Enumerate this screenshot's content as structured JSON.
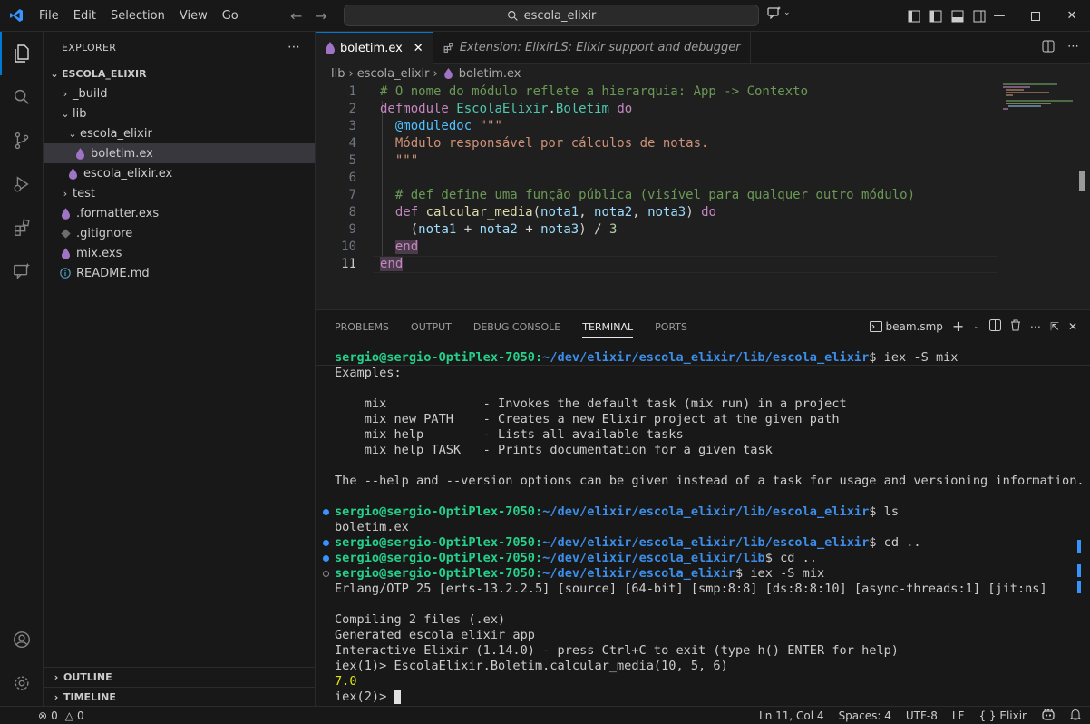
{
  "menu": [
    "File",
    "Edit",
    "Selection",
    "View",
    "Go"
  ],
  "search": {
    "text": "escola_elixir"
  },
  "explorer": {
    "header": "EXPLORER",
    "root": "ESCOLA_ELIXIR",
    "items": [
      {
        "label": "_build",
        "type": "folder",
        "open": false,
        "depth": 1
      },
      {
        "label": "lib",
        "type": "folder",
        "open": true,
        "depth": 1
      },
      {
        "label": "escola_elixir",
        "type": "folder",
        "open": true,
        "depth": 2
      },
      {
        "label": "boletim.ex",
        "type": "elixir",
        "depth": 3,
        "selected": true
      },
      {
        "label": "escola_elixir.ex",
        "type": "elixir",
        "depth": 2
      },
      {
        "label": "test",
        "type": "folder",
        "open": false,
        "depth": 1
      },
      {
        "label": ".formatter.exs",
        "type": "elixir-script",
        "depth": 1
      },
      {
        "label": ".gitignore",
        "type": "git",
        "depth": 1
      },
      {
        "label": "mix.exs",
        "type": "elixir-script",
        "depth": 1
      },
      {
        "label": "README.md",
        "type": "info",
        "depth": 1
      }
    ],
    "outline": "OUTLINE",
    "timeline": "TIMELINE"
  },
  "tabs": [
    {
      "label": "boletim.ex",
      "active": true
    },
    {
      "label": "Extension: ElixirLS: Elixir support and debugger",
      "active": false
    }
  ],
  "breadcrumb": [
    "lib",
    "escola_elixir",
    "boletim.ex"
  ],
  "code": {
    "current_line": 11,
    "lines": [
      [
        [
          "# O nome do módulo reflete a hierarquia: App -> Contexto",
          "com"
        ]
      ],
      [
        [
          "defmodule ",
          "kw"
        ],
        [
          "EscolaElixir",
          "mod"
        ],
        [
          ".",
          "plain"
        ],
        [
          "Boletim",
          "mod"
        ],
        [
          " do",
          "kw"
        ]
      ],
      [
        [
          "  ",
          "plain"
        ],
        [
          "@moduledoc",
          "attr"
        ],
        [
          " \"\"\"",
          "str"
        ]
      ],
      [
        [
          "  Módulo responsável por cálculos de notas.",
          "str"
        ]
      ],
      [
        [
          "  \"\"\"",
          "str"
        ]
      ],
      [
        [
          "",
          "plain"
        ]
      ],
      [
        [
          "  # def define uma função pública (visível para qualquer outro módulo)",
          "com"
        ]
      ],
      [
        [
          "  ",
          "plain"
        ],
        [
          "def ",
          "kw"
        ],
        [
          "calcular_media",
          "fn"
        ],
        [
          "(",
          "plain"
        ],
        [
          "nota1",
          "var"
        ],
        [
          ", ",
          "plain"
        ],
        [
          "nota2",
          "var"
        ],
        [
          ", ",
          "plain"
        ],
        [
          "nota3",
          "var"
        ],
        [
          ") ",
          "plain"
        ],
        [
          "do",
          "kw"
        ]
      ],
      [
        [
          "    (",
          "plain"
        ],
        [
          "nota1",
          "var"
        ],
        [
          " + ",
          "plain"
        ],
        [
          "nota2",
          "var"
        ],
        [
          " + ",
          "plain"
        ],
        [
          "nota3",
          "var"
        ],
        [
          ") / ",
          "plain"
        ],
        [
          "3",
          "num"
        ]
      ],
      [
        [
          "  ",
          "plain"
        ],
        [
          "end",
          "kw-hl"
        ]
      ],
      [
        [
          "end",
          "kw-hl"
        ]
      ]
    ]
  },
  "panel": {
    "tabs": [
      "PROBLEMS",
      "OUTPUT",
      "DEBUG CONSOLE",
      "TERMINAL",
      "PORTS"
    ],
    "active_tab": "TERMINAL",
    "terminal_name": "beam.smp"
  },
  "terminal": {
    "user": "sergio@sergio-OptiPlex-7050",
    "lines": [
      {
        "kind": "prompt",
        "path": "~/dev/elixir/escola_elixir/lib/escola_elixir",
        "cmd": " iex -S mix"
      },
      {
        "kind": "text",
        "text": "Examples:"
      },
      {
        "kind": "text",
        "text": ""
      },
      {
        "kind": "text",
        "text": "    mix             - Invokes the default task (mix run) in a project"
      },
      {
        "kind": "text",
        "text": "    mix new PATH    - Creates a new Elixir project at the given path"
      },
      {
        "kind": "text",
        "text": "    mix help        - Lists all available tasks"
      },
      {
        "kind": "text",
        "text": "    mix help TASK   - Prints documentation for a given task"
      },
      {
        "kind": "text",
        "text": ""
      },
      {
        "kind": "text",
        "text": "The --help and --version options can be given instead of a task for usage and versioning information."
      },
      {
        "kind": "text",
        "text": ""
      },
      {
        "kind": "prompt",
        "path": "~/dev/elixir/escola_elixir/lib/escola_elixir",
        "cmd": " ls",
        "deco": "ok"
      },
      {
        "kind": "text",
        "text": "boletim.ex"
      },
      {
        "kind": "prompt",
        "path": "~/dev/elixir/escola_elixir/lib/escola_elixir",
        "cmd": " cd ..",
        "deco": "ok"
      },
      {
        "kind": "prompt",
        "path": "~/dev/elixir/escola_elixir/lib",
        "cmd": " cd ..",
        "deco": "ok"
      },
      {
        "kind": "prompt",
        "path": "~/dev/elixir/escola_elixir",
        "cmd": " iex -S mix",
        "deco": "run"
      },
      {
        "kind": "text",
        "text": "Erlang/OTP 25 [erts-13.2.2.5] [source] [64-bit] [smp:8:8] [ds:8:8:10] [async-threads:1] [jit:ns]"
      },
      {
        "kind": "text",
        "text": ""
      },
      {
        "kind": "text",
        "text": "Compiling 2 files (.ex)"
      },
      {
        "kind": "text",
        "text": "Generated escola_elixir app"
      },
      {
        "kind": "text",
        "text": "Interactive Elixir (1.14.0) - press Ctrl+C to exit (type h() ENTER for help)"
      },
      {
        "kind": "text",
        "text": "iex(1)> EscolaElixir.Boletim.calcular_media(10, 5, 6)"
      },
      {
        "kind": "yellow",
        "text": "7.0"
      },
      {
        "kind": "input",
        "text": "iex(2)> "
      }
    ]
  },
  "status": {
    "errors": "0",
    "warnings": "0",
    "position": "Ln 11, Col 4",
    "spaces": "Spaces: 4",
    "encoding": "UTF-8",
    "eol": "LF",
    "language": "Elixir"
  },
  "colors": {
    "accent": "#0078d4",
    "elixir": "#a074c4",
    "prompt_user": "#23d18b",
    "prompt_path": "#3b8eea"
  }
}
